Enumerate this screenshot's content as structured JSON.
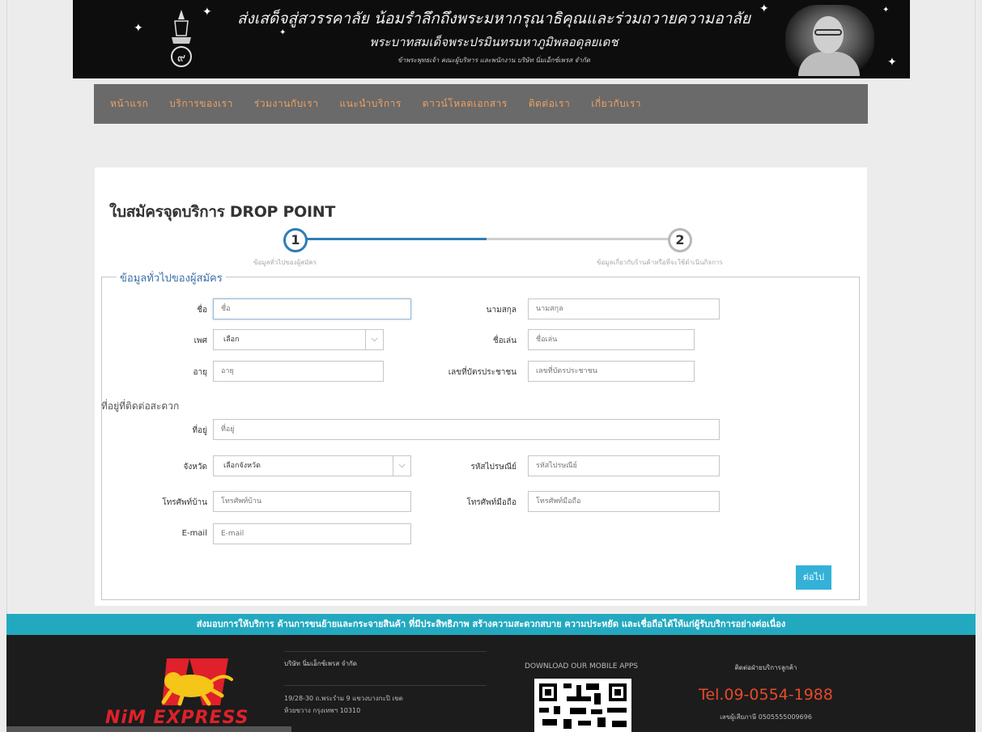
{
  "banner": {
    "line1": "ส่งเสด็จสู่สวรรคาลัย น้อมรำลึกถึงพระมหากรุณาธิคุณและร่วมถวายความอาลัย",
    "line2": "พระบาทสมเด็จพระปรมินทรมหาภูมิพลอดุลยเดช",
    "line3": "ข้าพระพุทธเจ้า คณะผู้บริหาร และพนักงาน บริษัท นิ่มเอ็กซ์เพรส จำกัด"
  },
  "nav": {
    "items": [
      "หน้าแรก",
      "บริการของเรา",
      "ร่วมงานกับเรา",
      "แนะนำบริการ",
      "ดาวน์โหลดเอกสาร",
      "ติดต่อเรา",
      "เกี่ยวกับเรา"
    ]
  },
  "form": {
    "title": "ใบสมัครจุดบริการ DROP POINT",
    "steps": [
      {
        "number": "1",
        "label": "ข้อมูลทั่วไปของผู้สมัคร"
      },
      {
        "number": "2",
        "label": "ข้อมูลเกี่ยวกับร้านค้าหรือที่จะใช้ดำเนินกิจการ"
      }
    ],
    "legend": "ข้อมูลทั่วไปของผู้สมัคร",
    "fields": {
      "first_name": {
        "label": "ชื่อ",
        "placeholder": "ชื่อ"
      },
      "last_name": {
        "label": "นามสกุล",
        "placeholder": "นามสกุล"
      },
      "gender": {
        "label": "เพศ",
        "value": "เลือก"
      },
      "nickname": {
        "label": "ชื่อเล่น",
        "placeholder": "ชื่อเล่น"
      },
      "age": {
        "label": "อายุ",
        "placeholder": "อายุ"
      },
      "id_card": {
        "label": "เลขที่บัตรประชาชน",
        "placeholder": "เลขที่บัตรประชาชน"
      },
      "address_heading": "ที่อยู่ที่ติดต่อสะดวก",
      "address": {
        "label": "ที่อยู่",
        "placeholder": "ที่อยู่"
      },
      "province": {
        "label": "จังหวัด",
        "value": "เลือกจังหวัด"
      },
      "postcode": {
        "label": "รหัสไปรษณีย์",
        "placeholder": "รหัสไปรษณีย์"
      },
      "home_phone": {
        "label": "โทรศัพท์บ้าน",
        "placeholder": "โทรศัพท์บ้าน"
      },
      "mobile": {
        "label": "โทรศัพท์มือถือ",
        "placeholder": "โทรศัพท์มือถือ"
      },
      "email": {
        "label": "E-mail",
        "placeholder": "E-mail"
      }
    },
    "next_label": "ต่อไป"
  },
  "footer": {
    "tagline": "ส่งมอบการให้บริการ ด้านการขนย้ายและกระจายสินค้า ที่มีประสิทธิภาพ สร้างความสะดวกสบาย ความประหยัด และเชื่อถือได้ให้แก่ผู้รับบริการอย่างต่อเนื่อง",
    "logo_text": "NiM EXPRESS",
    "company_name": "บริษัท นิ่มเอ็กซ์เพรส จำกัด",
    "address_line1": "19/28-30 ถ.พระรำม 9 แขวงบางกะปิ เขต",
    "address_line2": "ห้วยขวาง กรุงเทพฯ 10310",
    "apps_heading": "DOWNLOAD OUR MOBILE APPS",
    "contact_heading": "ติดต่อฝ่ายบริการลูกค้า",
    "tel": "Tel.09-0554-1988",
    "hotline": "เลขผู้เสียภาษี 0505555009696"
  },
  "colors": {
    "nav_bg": "#6a6a6a",
    "nav_text": "#f0a060",
    "step_active": "#2e7db6",
    "button": "#33b1d8",
    "tagline_bg": "#22a9c0",
    "tel": "#e64a2a",
    "logo_red": "#e0202a"
  }
}
